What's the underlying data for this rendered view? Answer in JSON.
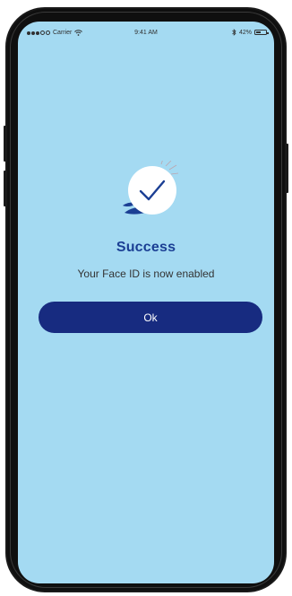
{
  "status_bar": {
    "carrier": "Carrier",
    "time": "9:41 AM",
    "battery_percent": "42%",
    "battery_level": 0.42,
    "icons": [
      "signal-dots-icon",
      "wifi-icon",
      "bluetooth-icon",
      "battery-icon"
    ]
  },
  "success": {
    "title": "Success",
    "message": "Your Face ID is now enabled",
    "icon": "checkmark-icon"
  },
  "actions": {
    "ok_label": "Ok"
  },
  "colors": {
    "background": "#a4daf2",
    "accent": "#1b3f94",
    "button": "#172b80",
    "button_text": "#ffffff"
  }
}
